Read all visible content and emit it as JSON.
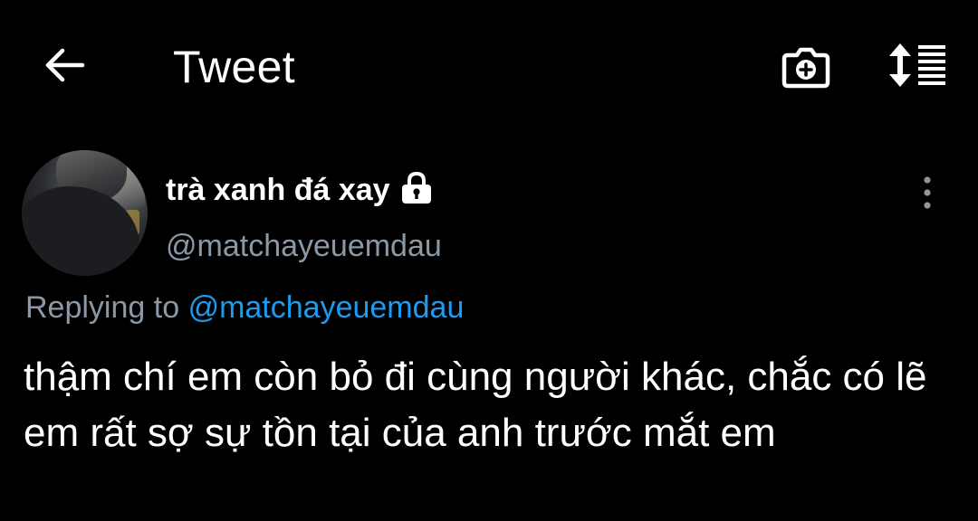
{
  "header": {
    "title": "Tweet",
    "back_icon": "arrow-left-icon",
    "camera_icon": "camera-plus-icon",
    "sort_icon": "sort-lines-icon"
  },
  "tweet": {
    "author": {
      "display_name": "trà xanh đá xay",
      "handle": "@matchayeuemdau",
      "protected": true,
      "lock_icon": "lock-icon"
    },
    "more_icon": "more-vertical-icon",
    "reply": {
      "prefix": "Replying to",
      "mention": "@matchayeuemdau"
    },
    "text": "thậm chí em còn bỏ đi cùng người khác, chắc có lẽ em rất sợ sự tồn tại của anh trước mắt em"
  },
  "colors": {
    "background": "#000000",
    "text": "#ffffff",
    "secondary_text": "#8b98a5",
    "link": "#1d9bf0"
  }
}
